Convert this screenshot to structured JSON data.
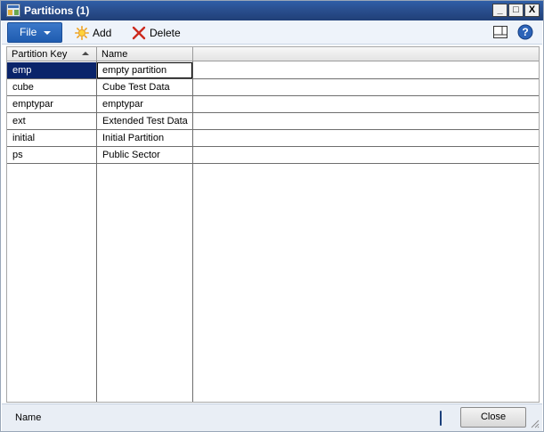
{
  "window": {
    "title": "Partitions (1)"
  },
  "caption": {
    "minimize": "_",
    "maximize": "□",
    "close": "X"
  },
  "toolbar": {
    "file_label": "File",
    "add_label": "Add",
    "delete_label": "Delete",
    "icons": [
      "sun-add-icon",
      "red-x-delete-icon",
      "layout-icon",
      "help-icon"
    ]
  },
  "grid": {
    "columns": [
      "Partition Key",
      "Name"
    ],
    "sorted_column": "Partition Key",
    "rows": [
      {
        "key": "emp",
        "name": "empty partition"
      },
      {
        "key": "cube",
        "name": "Cube Test Data"
      },
      {
        "key": "emptypar",
        "name": "emptypar"
      },
      {
        "key": "ext",
        "name": "Extended Test Data"
      },
      {
        "key": "initial",
        "name": "Initial Partition"
      },
      {
        "key": "ps",
        "name": "Public Sector"
      }
    ],
    "selected_row": "emp"
  },
  "status": {
    "field_label": "Name",
    "close_label": "Close"
  },
  "colors": {
    "title_bar": "#2a4f8f",
    "file_button": "#1f5cb0",
    "selection": "#0a246a",
    "delete_icon": "#cc2a1e"
  }
}
